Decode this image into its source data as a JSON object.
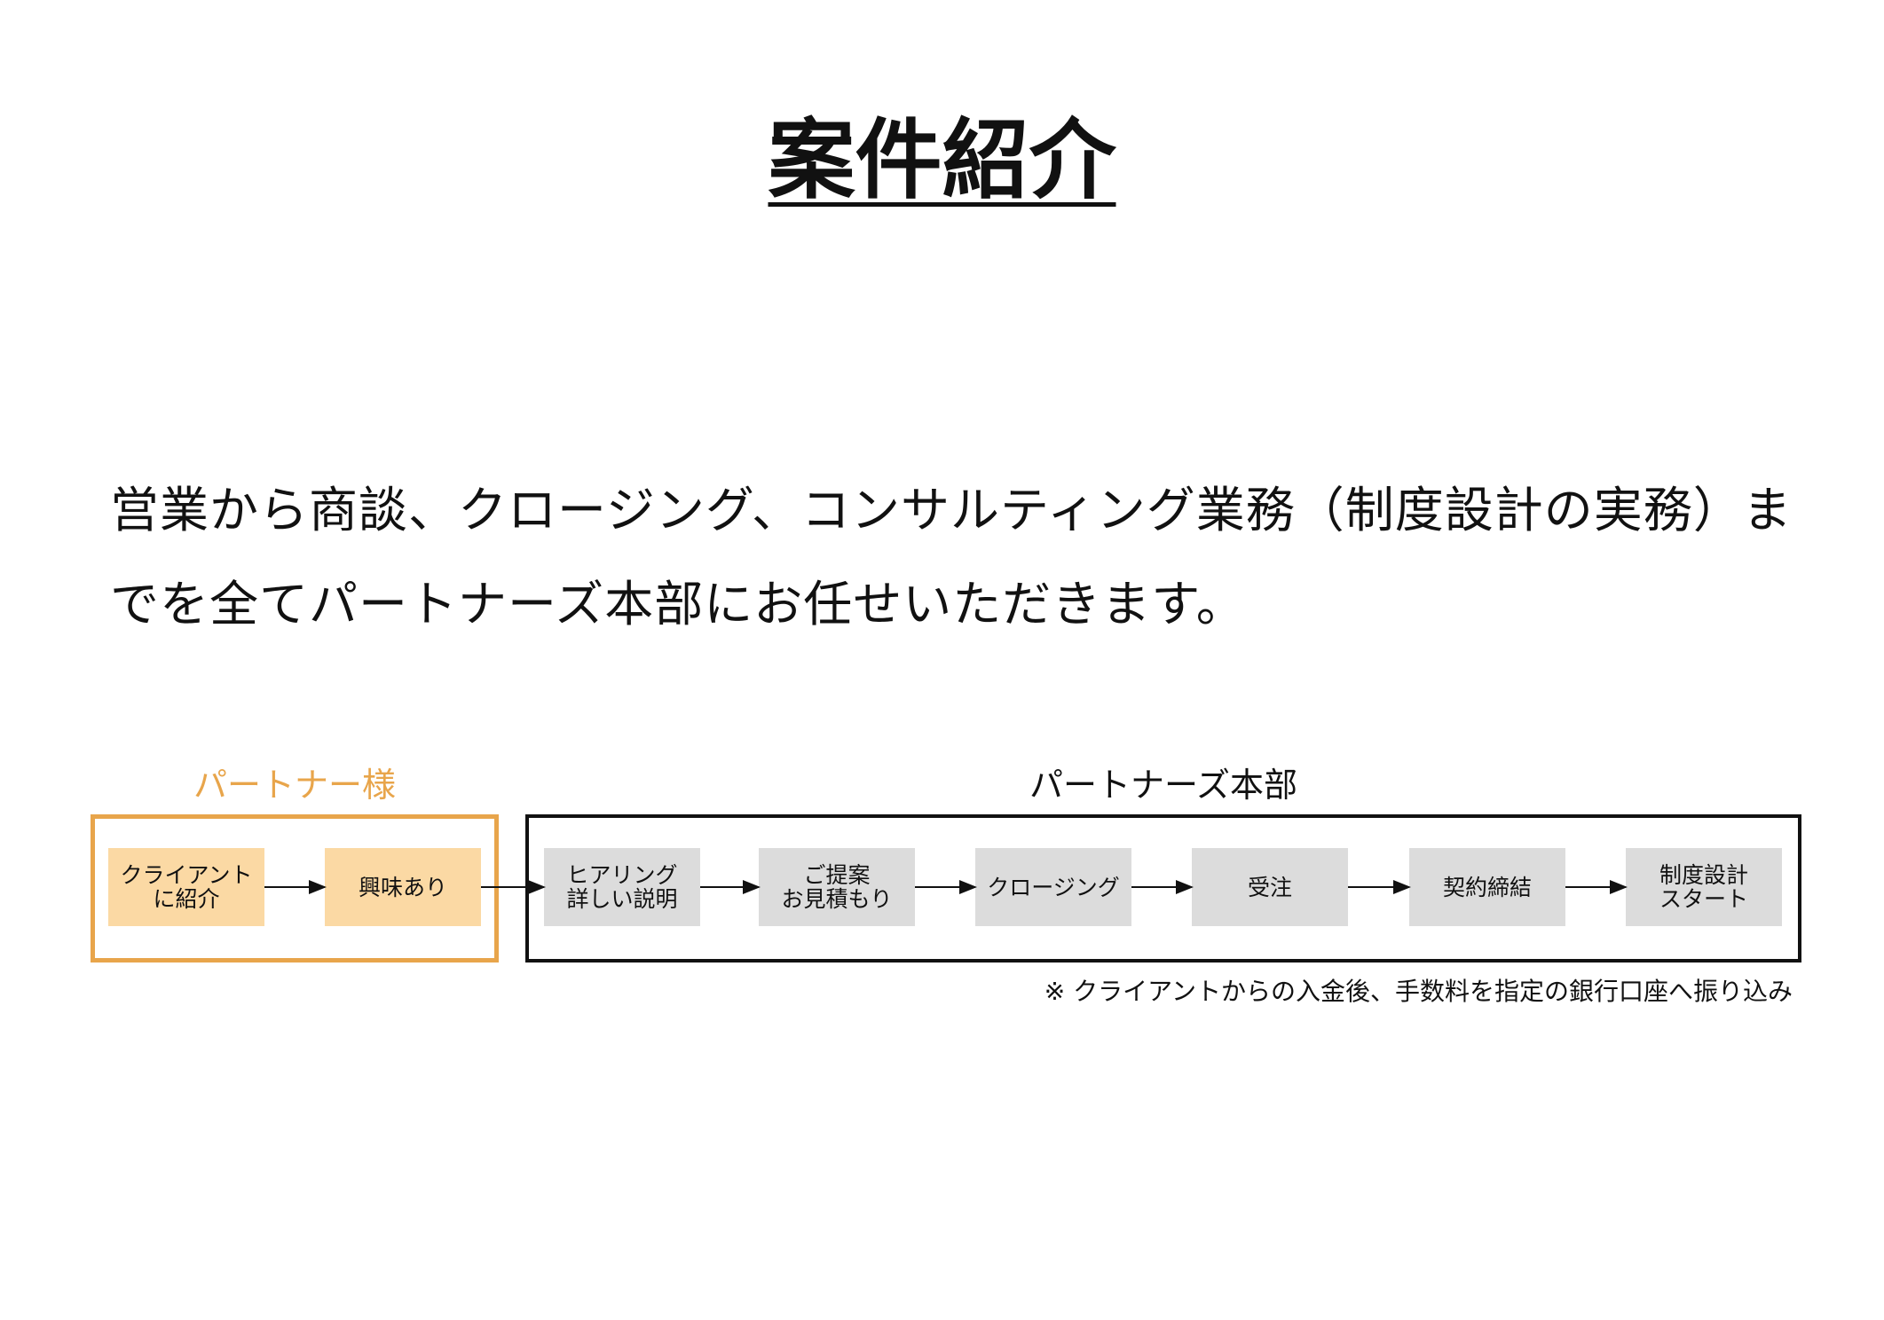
{
  "title": "案件紹介",
  "description": {
    "line1": "営業から商談、クロージング、コンサルティング業務（制度設計の実務）ま",
    "line2": "でを全てパートナーズ本部にお任せいただきます。"
  },
  "groups": {
    "partner": {
      "label": "パートナー様",
      "color": "#e8a54b"
    },
    "hq": {
      "label": "パートナーズ本部",
      "color": "#111111"
    }
  },
  "steps": [
    {
      "label": "クライアント\nに紹介",
      "group": "partner"
    },
    {
      "label": "興味あり",
      "group": "partner"
    },
    {
      "label": "ヒアリング\n詳しい説明",
      "group": "hq"
    },
    {
      "label": "ご提案\nお見積もり",
      "group": "hq"
    },
    {
      "label": "クロージング",
      "group": "hq"
    },
    {
      "label": "受注",
      "group": "hq"
    },
    {
      "label": "契約締結",
      "group": "hq"
    },
    {
      "label": "制度設計\nスタート",
      "group": "hq"
    }
  ],
  "footnote": "※ クライアントからの入金後、手数料を指定の銀行口座へ振り込み",
  "colors": {
    "partner_fill": "#fbd9a4",
    "hq_fill": "#dcdcdc",
    "arrow": "#111111"
  }
}
